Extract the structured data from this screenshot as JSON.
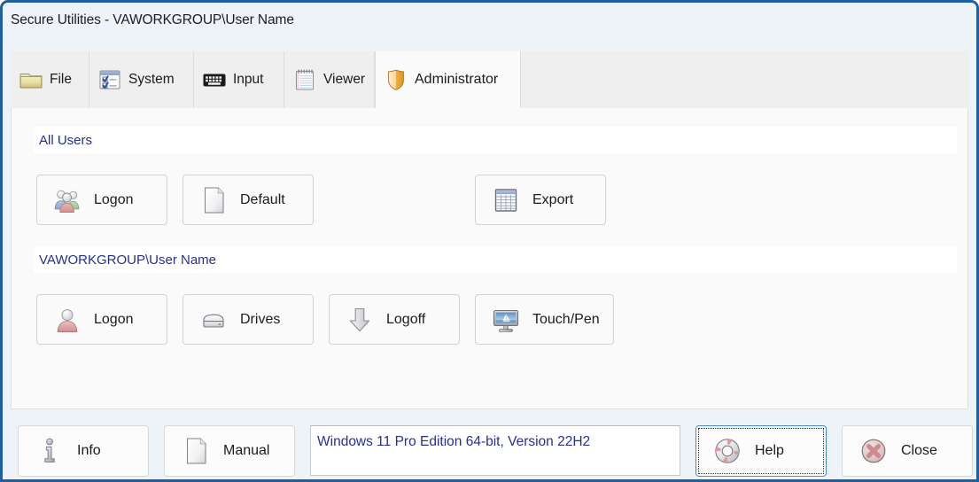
{
  "window": {
    "title": "Secure Utilities - VAWORKGROUP\\User Name",
    "accent_color": "#1f5fa0",
    "titlebar_bg": "#eef2f9",
    "panel_bg": "#fafafa"
  },
  "tabs": [
    {
      "label": "File",
      "icon": "folder-icon",
      "selected": false
    },
    {
      "label": "System",
      "icon": "checklist-icon",
      "selected": false
    },
    {
      "label": "Input",
      "icon": "keyboard-icon",
      "selected": false
    },
    {
      "label": "Viewer",
      "icon": "notepad-icon",
      "selected": false
    },
    {
      "label": "Administrator",
      "icon": "shield-icon",
      "selected": true
    }
  ],
  "sections": [
    {
      "header": "All Users",
      "header_color": "#26308f",
      "buttons": [
        {
          "label": "Logon",
          "icon": "users-group-icon"
        },
        {
          "label": "Default",
          "icon": "blank-document-icon"
        },
        {
          "label": "Export",
          "icon": "spreadsheet-icon"
        }
      ]
    },
    {
      "header": "VAWORKGROUP\\User Name",
      "header_color": "#26308f",
      "buttons": [
        {
          "label": "Logon",
          "icon": "single-user-icon"
        },
        {
          "label": "Drives",
          "icon": "hard-drive-icon"
        },
        {
          "label": "Logoff",
          "icon": "down-arrow-icon"
        },
        {
          "label": "Touch/Pen",
          "icon": "monitor-icon"
        }
      ]
    }
  ],
  "bottom_bar": {
    "buttons": [
      {
        "label": "Info",
        "icon": "info-icon",
        "focused": false
      },
      {
        "label": "Manual",
        "icon": "document-icon",
        "focused": false
      },
      {
        "label": "Help",
        "icon": "lifering-icon",
        "focused": true
      },
      {
        "label": "Close",
        "icon": "x-circle-icon",
        "focused": false
      }
    ],
    "status": {
      "text": "Windows 11 Pro Edition 64-bit, Version 22H2",
      "color": "#26308f"
    }
  }
}
